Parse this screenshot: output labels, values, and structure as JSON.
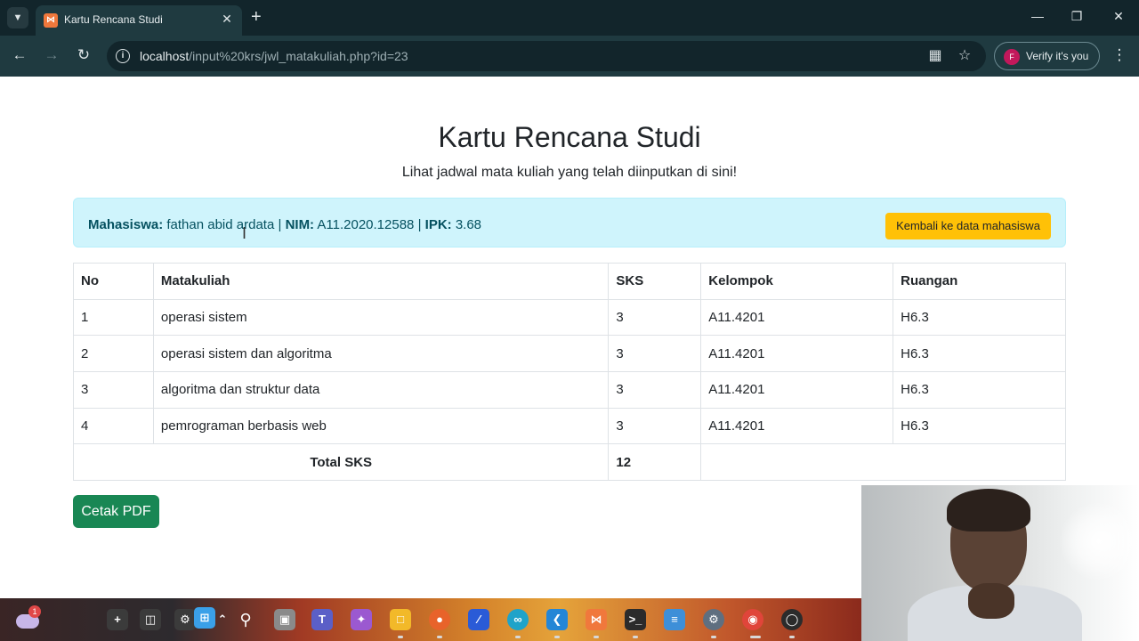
{
  "browser": {
    "tab_title": "Kartu Rencana Studi",
    "favicon": "xampp-icon",
    "url_host": "localhost",
    "url_path": "/input%20krs/jwl_matakuliah.php?id=23",
    "verify_label": "Verify it's you",
    "profile_initial": "F"
  },
  "page": {
    "title": "Kartu Rencana Studi",
    "subtitle": "Lihat jadwal mata kuliah yang telah diinputkan di sini!"
  },
  "student": {
    "name_label": "Mahasiswa:",
    "name": "fathan abid ardata",
    "separator": "|",
    "nim_label": "NIM:",
    "nim": "A11.2020.12588",
    "ipk_label": "IPK:",
    "ipk": "3.68",
    "back_button": "Kembali ke data mahasiswa"
  },
  "table": {
    "headers": [
      "No",
      "Matakuliah",
      "SKS",
      "Kelompok",
      "Ruangan"
    ],
    "rows": [
      [
        "1",
        "operasi sistem",
        "3",
        "A11.4201",
        "H6.3"
      ],
      [
        "2",
        "operasi sistem dan algoritma",
        "3",
        "A11.4201",
        "H6.3"
      ],
      [
        "3",
        "algoritma dan struktur data",
        "3",
        "A11.4201",
        "H6.3"
      ],
      [
        "4",
        "pemrograman berbasis web",
        "3",
        "A11.4201",
        "H6.3"
      ]
    ],
    "total_label": "Total SKS",
    "total_value": "12"
  },
  "actions": {
    "pdf_button": "Cetak PDF"
  },
  "taskbar": {
    "weather_badge": "1",
    "teams_letter": "T"
  },
  "colors": {
    "info_bg": "#cff4fc",
    "warning": "#ffc107",
    "success": "#198754",
    "chrome_dark": "#12252b",
    "chrome_toolbar": "#1f3a40"
  }
}
